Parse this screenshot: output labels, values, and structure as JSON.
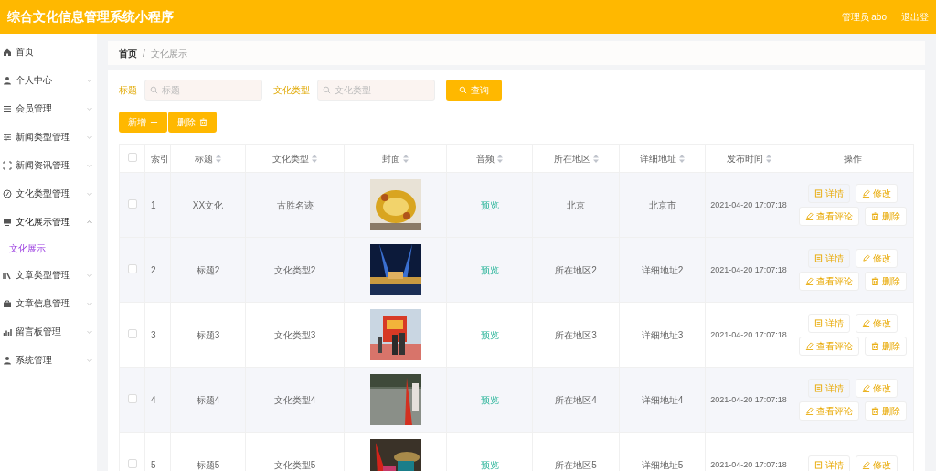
{
  "header": {
    "title": "综合文化信息管理系统小程序",
    "user": "管理员 abo",
    "logout": "退出登"
  },
  "sidebar": {
    "items": [
      {
        "label": "首页"
      },
      {
        "label": "个人中心",
        "expanded": false
      },
      {
        "label": "会员管理",
        "expanded": false
      },
      {
        "label": "新闻类型管理",
        "expanded": false
      },
      {
        "label": "新闻资讯管理",
        "expanded": false
      },
      {
        "label": "文化类型管理",
        "expanded": false
      },
      {
        "label": "文化展示管理",
        "expanded": true,
        "children": [
          {
            "label": "文化展示",
            "selected": true
          }
        ]
      },
      {
        "label": "文章类型管理",
        "expanded": false
      },
      {
        "label": "文章信息管理",
        "expanded": false
      },
      {
        "label": "留言板管理",
        "expanded": false
      },
      {
        "label": "系统管理",
        "expanded": false
      }
    ]
  },
  "breadcrumb": {
    "items": [
      "首页",
      "文化展示"
    ],
    "separator": "/"
  },
  "search": {
    "fields": [
      {
        "label": "标题",
        "placeholder": "标题"
      },
      {
        "label": "文化类型",
        "placeholder": "文化类型"
      }
    ],
    "button": "查询"
  },
  "actions": [
    {
      "label": "新增",
      "kind": "add"
    },
    {
      "label": "删除",
      "kind": "delete"
    }
  ],
  "table": {
    "select_all": {
      "checked": false
    },
    "columns": [
      {
        "label": "索引",
        "sortable": false
      },
      {
        "label": "标题",
        "sortable": true
      },
      {
        "label": "文化类型",
        "sortable": true
      },
      {
        "label": "封面",
        "sortable": true
      },
      {
        "label": "音频",
        "sortable": true
      },
      {
        "label": "所在地区",
        "sortable": true
      },
      {
        "label": "详细地址",
        "sortable": true
      },
      {
        "label": "发布时间",
        "sortable": true
      },
      {
        "label": "操作",
        "sortable": false
      }
    ],
    "rows": [
      {
        "index": "1",
        "title": "XX文化",
        "type": "古胜名迹",
        "cover": {
          "kind": "picture"
        },
        "audio": "预览",
        "region": "北京",
        "address": "北京市",
        "time": "2021-04-20 17:07:18",
        "highlighted": true,
        "checked": false,
        "buttons": [
          {
            "label": "详情",
            "kind": "detail"
          },
          {
            "label": "修改",
            "kind": "edit"
          },
          {
            "label": "查看评论",
            "kind": "edit"
          },
          {
            "label": "删除",
            "kind": "delete"
          }
        ]
      },
      {
        "index": "2",
        "title": "标题2",
        "type": "文化类型2",
        "cover": {
          "kind": "picture"
        },
        "audio": "预览",
        "region": "所在地区2",
        "address": "详细地址2",
        "time": "2021-04-20 17:07:18",
        "highlighted": true,
        "checked": false,
        "buttons": [
          {
            "label": "详情",
            "kind": "detail"
          },
          {
            "label": "修改",
            "kind": "edit"
          },
          {
            "label": "查看评论",
            "kind": "edit"
          },
          {
            "label": "删除",
            "kind": "delete"
          }
        ]
      },
      {
        "index": "3",
        "title": "标题3",
        "type": "文化类型3",
        "cover": {
          "kind": "picture"
        },
        "audio": "预览",
        "region": "所在地区3",
        "address": "详细地址3",
        "time": "2021-04-20 17:07:18",
        "highlighted": false,
        "checked": false,
        "buttons": [
          {
            "label": "详情",
            "kind": "detail"
          },
          {
            "label": "修改",
            "kind": "edit"
          },
          {
            "label": "查看评论",
            "kind": "edit"
          },
          {
            "label": "删除",
            "kind": "delete"
          }
        ]
      },
      {
        "index": "4",
        "title": "标题4",
        "type": "文化类型4",
        "cover": {
          "kind": "picture"
        },
        "audio": "预览",
        "region": "所在地区4",
        "address": "详细地址4",
        "time": "2021-04-20 17:07:18",
        "highlighted": true,
        "checked": false,
        "buttons": [
          {
            "label": "详情",
            "kind": "detail"
          },
          {
            "label": "修改",
            "kind": "edit"
          },
          {
            "label": "查看评论",
            "kind": "edit"
          },
          {
            "label": "删除",
            "kind": "delete"
          }
        ]
      },
      {
        "index": "5",
        "title": "标题5",
        "type": "文化类型5",
        "cover": {
          "kind": "picture"
        },
        "audio": "预览",
        "region": "所在地区5",
        "address": "详细地址5",
        "time": "2021-04-20 17:07:18",
        "highlighted": false,
        "checked": false,
        "buttons": [
          {
            "label": "详情",
            "kind": "detail"
          },
          {
            "label": "修改",
            "kind": "edit"
          }
        ]
      }
    ]
  }
}
